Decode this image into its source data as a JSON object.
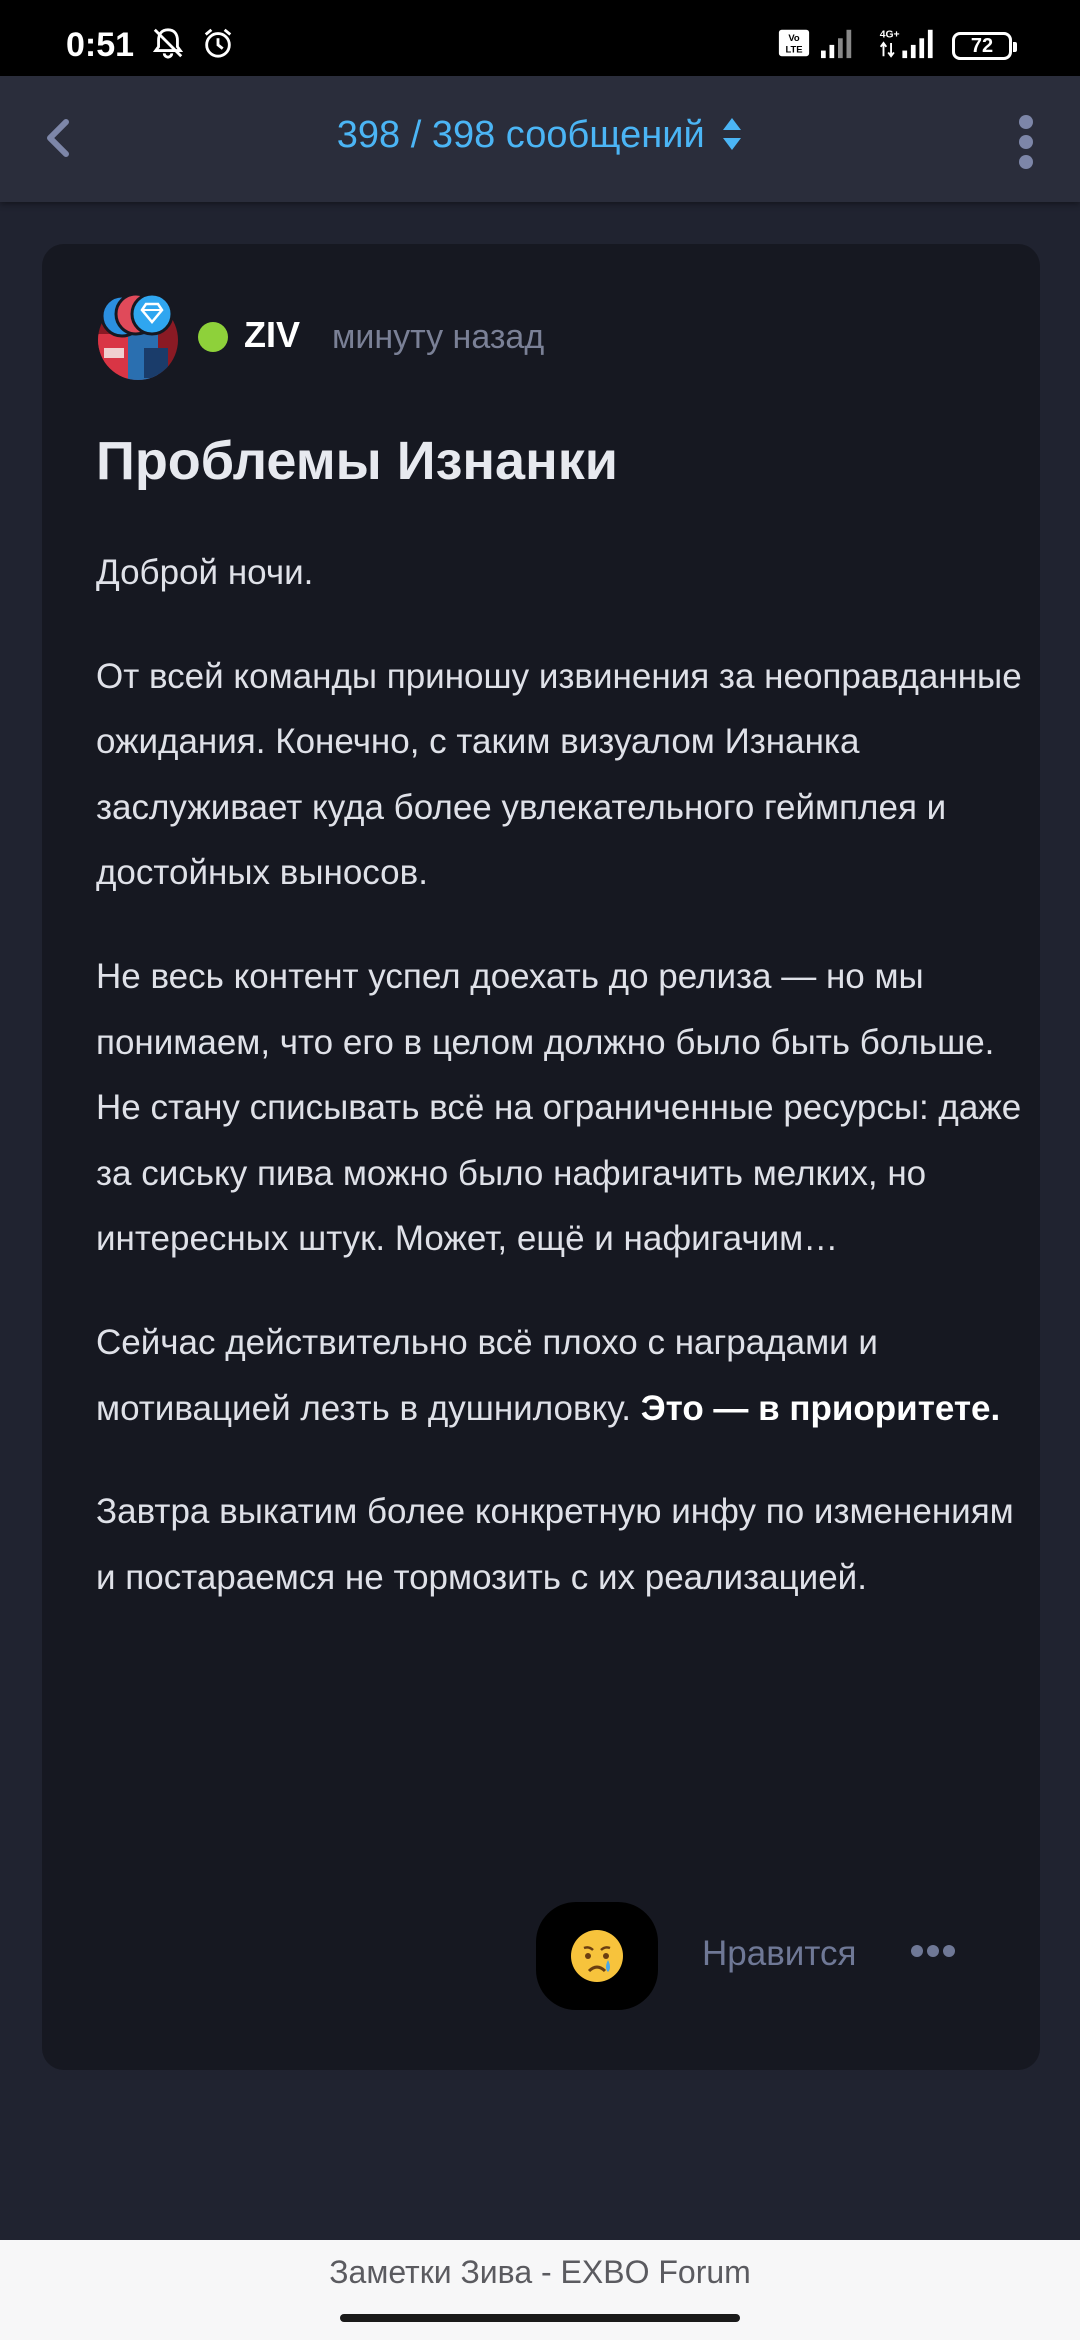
{
  "status_bar": {
    "time": "0:51",
    "battery": "72",
    "icons": [
      "mute-icon",
      "alarm-icon",
      "volte-icon",
      "signal-icon",
      "4g-signal-icon",
      "battery-icon"
    ]
  },
  "nav": {
    "title": "398 / 398 сообщений",
    "back_icon": "chevron-left-icon",
    "menu_icon": "more-vertical-icon",
    "accent": "#4bb5f5"
  },
  "post": {
    "author": "ZIV",
    "time": "минуту назад",
    "title": "Проблемы Изнанки",
    "paragraphs": [
      "Доброй ночи.",
      "От всей команды приношу извинения за неоправданные ожидания. Конечно, с таким визуалом Изнанка заслуживает куда более увлекательного геймплея и достойных выносов.",
      "Не весь контент успел доехать до релиза — но мы понимаем, что его в целом должно было быть больше. Не стану списывать всё на ограниченные ресурсы: даже за сиську пива можно было нафигачить мелких, но интересных штук. Может, ещё и нафигачим…",
      "Сейчас действительно всё плохо с наградами и мотивацией лезть в душниловку. ",
      "Завтра выкатим более конкретную инфу по изменениям и постараемся не тормозить с их реализацией."
    ],
    "emphasis": "Это — в приоритете.",
    "reaction": "crying-face-emoji",
    "like_label": "Нравится",
    "more_icon": "more-horizontal-icon",
    "online_color": "#8ed13a"
  },
  "bottom_bar": {
    "title": "Заметки Зива - EXBO Forum"
  }
}
